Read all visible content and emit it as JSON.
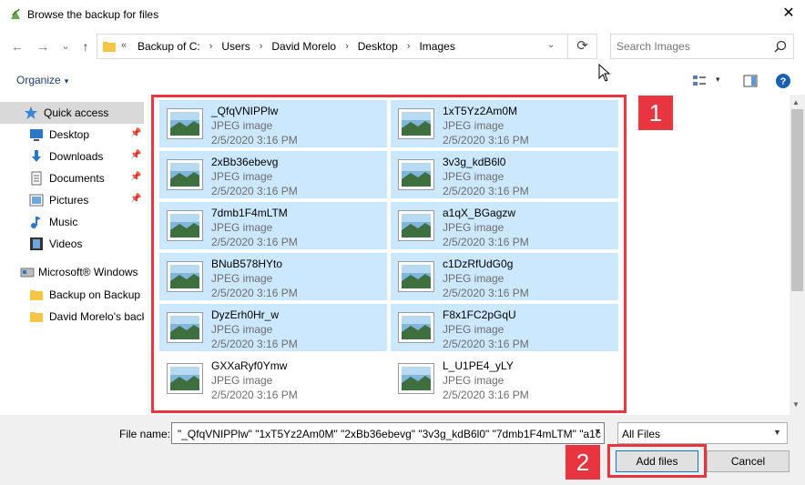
{
  "window": {
    "title": "Browse the backup for files",
    "close_symbol": "✕"
  },
  "nav": {
    "back_symbol": "←",
    "forward_symbol": "→",
    "recent_symbol": "⌄",
    "up_symbol": "↑",
    "overflow_symbol": "«",
    "breadcrumbs": [
      "Backup of C:",
      "Users",
      "David Morelo",
      "Desktop",
      "Images"
    ],
    "separator": "›",
    "refresh_symbol": "⟳"
  },
  "search": {
    "placeholder": "Search Images"
  },
  "toolbar": {
    "organize_label": "Organize",
    "dropdown_arrow": "▾"
  },
  "sidebar": {
    "pin_symbol": "📌",
    "items": [
      {
        "label": "Quick access",
        "icon": "star-icon",
        "active": true
      },
      {
        "label": "Desktop",
        "icon": "desktop-icon",
        "pinned": true
      },
      {
        "label": "Downloads",
        "icon": "download-icon",
        "pinned": true
      },
      {
        "label": "Documents",
        "icon": "documents-icon",
        "pinned": true
      },
      {
        "label": "Pictures",
        "icon": "pictures-icon",
        "pinned": true
      },
      {
        "label": "Music",
        "icon": "music-icon"
      },
      {
        "label": "Videos",
        "icon": "videos-icon"
      },
      {
        "label": "Microsoft® Windows",
        "icon": "windows-icon"
      },
      {
        "label": "Backup on Backup (",
        "icon": "folder-icon"
      },
      {
        "label": "David Morelo's back",
        "icon": "folder-icon"
      }
    ]
  },
  "files": [
    {
      "name": "_QfqVNIPPlw",
      "type": "JPEG image",
      "date": "2/5/2020 3:16 PM",
      "selected": true
    },
    {
      "name": "1xT5Yz2Am0M",
      "type": "JPEG image",
      "date": "2/5/2020 3:16 PM",
      "selected": true
    },
    {
      "name": "2xBb36ebevg",
      "type": "JPEG image",
      "date": "2/5/2020 3:16 PM",
      "selected": true
    },
    {
      "name": "3v3g_kdB6l0",
      "type": "JPEG image",
      "date": "2/5/2020 3:16 PM",
      "selected": true
    },
    {
      "name": "7dmb1F4mLTM",
      "type": "JPEG image",
      "date": "2/5/2020 3:16 PM",
      "selected": true
    },
    {
      "name": "a1qX_BGagzw",
      "type": "JPEG image",
      "date": "2/5/2020 3:16 PM",
      "selected": true
    },
    {
      "name": "BNuB578HYto",
      "type": "JPEG image",
      "date": "2/5/2020 3:16 PM",
      "selected": true
    },
    {
      "name": "c1DzRfUdG0g",
      "type": "JPEG image",
      "date": "2/5/2020 3:16 PM",
      "selected": true
    },
    {
      "name": "DyzErh0Hr_w",
      "type": "JPEG image",
      "date": "2/5/2020 3:16 PM",
      "selected": true
    },
    {
      "name": "F8x1FC2pGqU",
      "type": "JPEG image",
      "date": "2/5/2020 3:16 PM",
      "selected": true
    },
    {
      "name": "GXXaRyf0Ymw",
      "type": "JPEG image",
      "date": "2/5/2020 3:16 PM",
      "selected": false
    },
    {
      "name": "L_U1PE4_yLY",
      "type": "JPEG image",
      "date": "2/5/2020 3:16 PM",
      "selected": false
    }
  ],
  "footer": {
    "filename_label": "File name:",
    "filename_value": "\"_QfqVNIPPlw\" \"1xT5Yz2Am0M\" \"2xBb36ebevg\" \"3v3g_kdB6l0\" \"7dmb1F4mLTM\" \"a1c",
    "filetype_value": "All Files",
    "add_label": "Add files",
    "cancel_label": "Cancel"
  },
  "annotations": {
    "badge1": "1",
    "badge2": "2",
    "color": "#e8353f"
  },
  "colors": {
    "selection": "#cce8ff",
    "link": "#1e3f73",
    "accent_border": "#0078d7"
  }
}
